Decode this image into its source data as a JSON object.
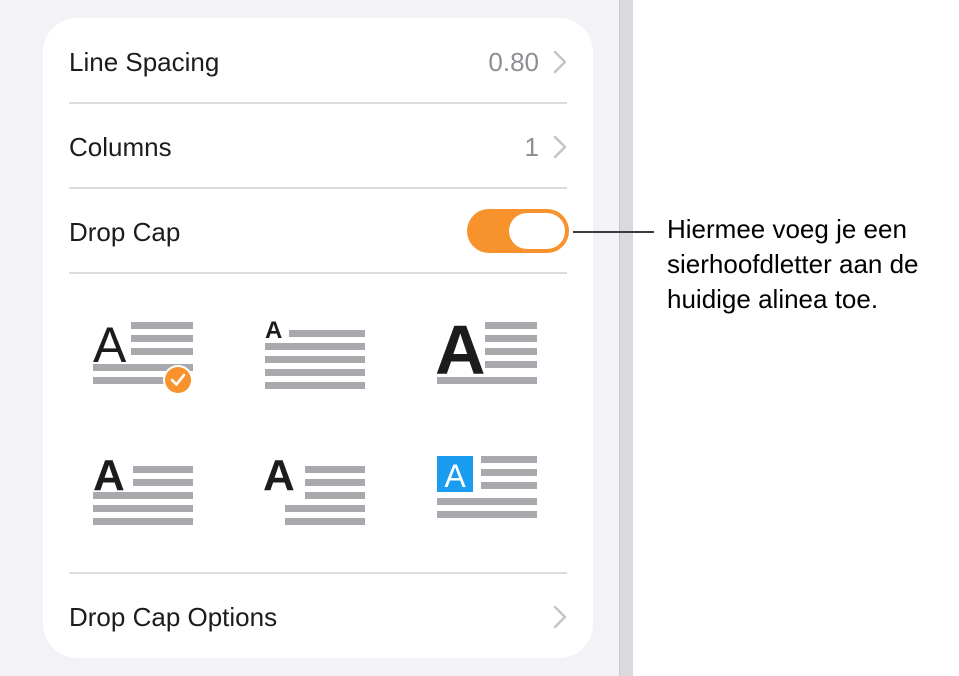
{
  "settings": {
    "line_spacing": {
      "label": "Line Spacing",
      "value": "0.80"
    },
    "columns": {
      "label": "Columns",
      "value": "1"
    },
    "drop_cap": {
      "label": "Drop Cap",
      "enabled": true
    },
    "drop_cap_options": {
      "label": "Drop Cap Options"
    }
  },
  "drop_cap_styles": [
    {
      "id": "style-1",
      "glyph": "A",
      "selected": true
    },
    {
      "id": "style-2",
      "glyph": "A",
      "selected": false
    },
    {
      "id": "style-3",
      "glyph": "A",
      "selected": false
    },
    {
      "id": "style-4",
      "glyph": "A",
      "selected": false
    },
    {
      "id": "style-5",
      "glyph": "A",
      "selected": false
    },
    {
      "id": "style-6",
      "glyph": "A",
      "selected": false
    }
  ],
  "callout": {
    "text": "Hiermee voeg je een sierhoofdletter aan de huidige alinea toe."
  },
  "colors": {
    "accent": "#f7922d",
    "blue_badge": "#1a9df0",
    "line_gray": "#a9a9ad"
  },
  "icons": {
    "chevron": "chevron-right-icon",
    "check": "checkmark-icon"
  }
}
